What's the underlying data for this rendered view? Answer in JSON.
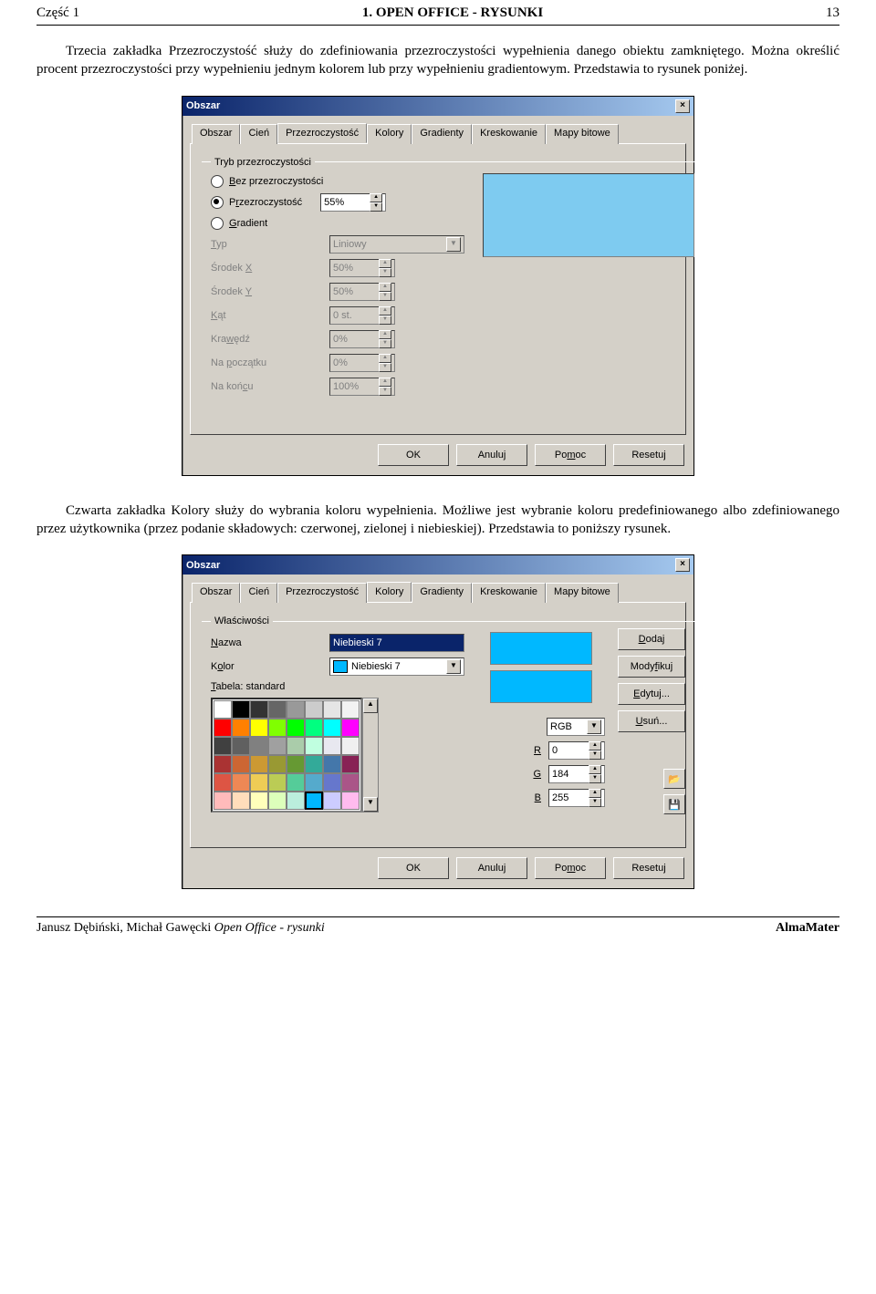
{
  "header": {
    "left": "Część 1",
    "center": "1. OPEN OFFICE - RYSUNKI",
    "right": "13"
  },
  "para1": "Trzecia zakładka Przezroczystość służy do zdefiniowania przezroczystości wypełnienia danego obiektu zamkniętego. Można określić procent przezroczystości przy wypełnieniu jednym kolorem lub przy wypełnieniu gradientowym. Przedstawia to rysunek poniżej.",
  "para2": "Czwarta zakładka Kolory służy do wybrania koloru wypełnienia. Możliwe jest wybranie koloru predefiniowanego albo zdefiniowanego przez użytkownika (przez podanie składowych: czerwonej, zielonej i niebieskiej). Przedstawia to poniższy rysunek.",
  "dialog1": {
    "title": "Obszar",
    "tabs": [
      "Obszar",
      "Cień",
      "Przezroczystość",
      "Kolory",
      "Gradienty",
      "Kreskowanie",
      "Mapy bitowe"
    ],
    "active_tab": "Przezroczystość",
    "groupbox": "Tryb przezroczystości",
    "radios": {
      "none": "Bez przezroczystości",
      "trans": "Przezroczystość",
      "grad": "Gradient"
    },
    "trans_value": "55%",
    "fields": {
      "typ": {
        "label": "Typ",
        "value": "Liniowy"
      },
      "srodekx": {
        "label": "Środek X",
        "value": "50%"
      },
      "srodeky": {
        "label": "Środek Y",
        "value": "50%"
      },
      "kat": {
        "label": "Kąt",
        "value": "0 st."
      },
      "krawedz": {
        "label": "Krawędź",
        "value": "0%"
      },
      "napocz": {
        "label": "Na początku",
        "value": "0%"
      },
      "nakon": {
        "label": "Na końcu",
        "value": "100%"
      }
    },
    "buttons": {
      "ok": "OK",
      "cancel": "Anuluj",
      "help": "Pomoc",
      "reset": "Resetuj"
    }
  },
  "dialog2": {
    "title": "Obszar",
    "tabs": [
      "Obszar",
      "Cień",
      "Przezroczystość",
      "Kolory",
      "Gradienty",
      "Kreskowanie",
      "Mapy bitowe"
    ],
    "active_tab": "Kolory",
    "groupbox": "Właściwości",
    "name_label": "Nazwa",
    "name_value": "Niebieski 7",
    "color_label": "Kolor",
    "color_value": "Niebieski 7",
    "table_label": "Tabela: standard",
    "model_label": "RGB",
    "rgb": {
      "r_label": "R",
      "r": "0",
      "g_label": "G",
      "g": "184",
      "b_label": "B",
      "b": "255"
    },
    "side_buttons": {
      "add": "Dodaj",
      "modify": "Modyfikuj",
      "edit": "Edytuj...",
      "delete": "Usuń..."
    },
    "preview_top": "#00b8ff",
    "preview_bottom": "#00b8ff",
    "palette": [
      "#ffffff",
      "#000000",
      "#333333",
      "#666666",
      "#999999",
      "#cccccc",
      "#e5e5e5",
      "#f2f2f2",
      "#ff0000",
      "#ff8000",
      "#ffff00",
      "#80ff00",
      "#00ff00",
      "#00ff80",
      "#00ffff",
      "#ff00ff",
      "#404040",
      "#606060",
      "#808080",
      "#a0a0a0",
      "#aaccaa",
      "#c0ffe0",
      "#e8e8f0",
      "#f0f0f0",
      "#aa3333",
      "#cc6633",
      "#cc9933",
      "#999933",
      "#669933",
      "#33aa99",
      "#4477aa",
      "#882255",
      "#dd5544",
      "#ee8855",
      "#eecc55",
      "#bbcc55",
      "#55cc99",
      "#55aacc",
      "#6677cc",
      "#aa5588",
      "#ffbbbb",
      "#ffddbb",
      "#ffffbb",
      "#ddffbb",
      "#bbeedd",
      "#00b8ff",
      "#ccccff",
      "#ffbbee"
    ],
    "selected_index": 45,
    "buttons": {
      "ok": "OK",
      "cancel": "Anuluj",
      "help": "Pomoc",
      "reset": "Resetuj"
    }
  },
  "footer": {
    "left_authors": "Janusz Dębiński, Michał Gawęcki ",
    "left_title": "Open Office - rysunki",
    "right": "AlmaMater"
  }
}
